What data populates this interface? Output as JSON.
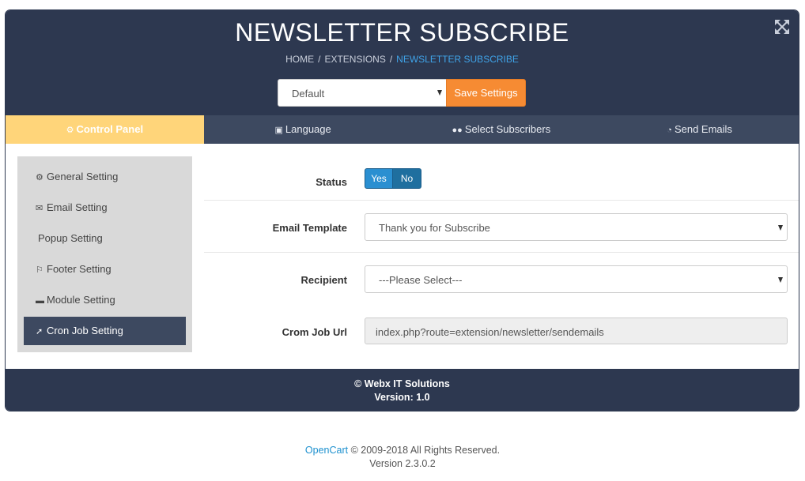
{
  "header": {
    "title": "NEWSLETTER SUBSCRIBE",
    "breadcrumb": [
      "HOME",
      "EXTENSIONS",
      "NEWSLETTER SUBSCRIBE"
    ],
    "store_select": "Default",
    "save_label": "Save Settings"
  },
  "tabs": [
    {
      "label": "Control Panel",
      "icon": "gear-icon"
    },
    {
      "label": "Language",
      "icon": "language-icon"
    },
    {
      "label": "Select Subscribers",
      "icon": "users-icon"
    },
    {
      "label": "Send Emails",
      "icon": "dashboard-icon"
    }
  ],
  "sidemenu": [
    {
      "label": "General Setting",
      "icon": "gear-icon"
    },
    {
      "label": "Email Setting",
      "icon": "envelope-icon"
    },
    {
      "label": "Popup Setting",
      "icon": ""
    },
    {
      "label": "Footer Setting",
      "icon": "flag-icon"
    },
    {
      "label": "Module Setting",
      "icon": "folder-icon"
    },
    {
      "label": "Cron Job Setting",
      "icon": "rocket-icon"
    }
  ],
  "form": {
    "status": {
      "label": "Status",
      "yes": "Yes",
      "no": "No"
    },
    "email_template": {
      "label": "Email Template",
      "value": "Thank you for Subscribe"
    },
    "recipient": {
      "label": "Recipient",
      "value": "---Please Select---"
    },
    "cron_url": {
      "label": "Crom Job Url",
      "value": "index.php?route=extension/newsletter/sendemails"
    }
  },
  "footer": {
    "line1": "© Webx IT Solutions",
    "line2": "Version: 1.0"
  },
  "page_footer": {
    "link": "OpenCart",
    "copyright": " © 2009-2018 All Rights Reserved.",
    "version": "Version 2.3.0.2"
  },
  "colors": {
    "header_bg": "#2d3850",
    "tab_bar_bg": "#3d4960",
    "active_tab": "#ffd57a",
    "save_button": "#f68b33",
    "link_blue": "#3fa3e8"
  }
}
